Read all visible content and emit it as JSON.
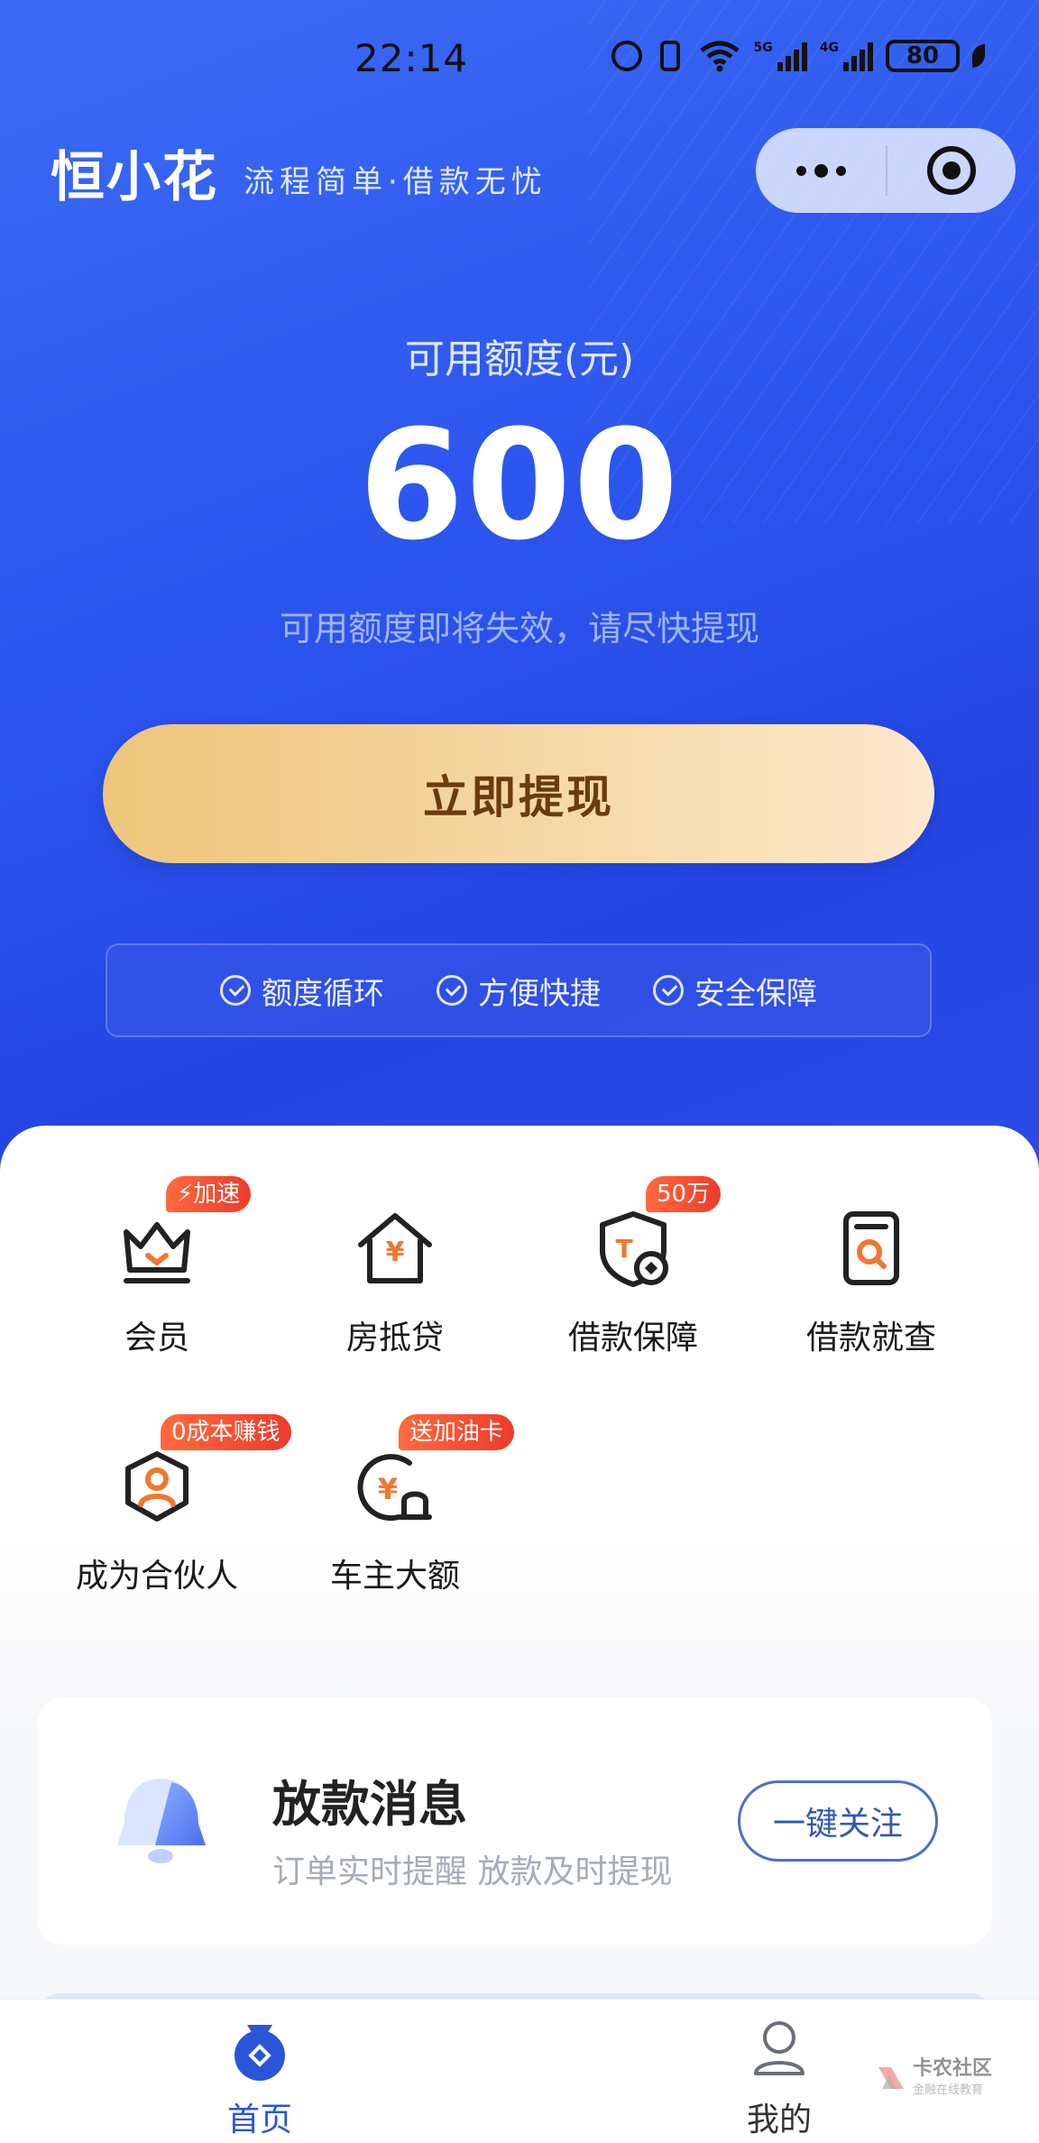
{
  "status_bar": {
    "time": "22:14",
    "network_a": "5G",
    "network_b": "4G",
    "battery": "80",
    "icons": [
      "alarm-icon",
      "vibrate-icon",
      "wifi-icon",
      "signal-5g-icon",
      "signal-4g-icon",
      "battery-icon",
      "leaf-icon"
    ]
  },
  "header": {
    "brand": "恒小花",
    "slogan": "流程简单·借款无忧",
    "capsule_icons": [
      "more-dots-icon",
      "close-target-icon"
    ]
  },
  "quota": {
    "label": "可用额度(元)",
    "value": "600",
    "tip": "可用额度即将失效，请尽快提现"
  },
  "cta": {
    "label": "立即提现"
  },
  "features": [
    {
      "label": "额度循环",
      "icon": "check-circle-icon"
    },
    {
      "label": "方便快捷",
      "icon": "check-circle-icon"
    },
    {
      "label": "安全保障",
      "icon": "check-circle-icon"
    }
  ],
  "services": [
    {
      "label": "会员",
      "icon": "crown-icon",
      "badge": "加速"
    },
    {
      "label": "房抵贷",
      "icon": "house-yuan-icon",
      "badge": ""
    },
    {
      "label": "借款保障",
      "icon": "shield-icon",
      "badge": "50万"
    },
    {
      "label": "借款就查",
      "icon": "search-doc-icon",
      "badge": ""
    },
    {
      "label": "成为合伙人",
      "icon": "partner-icon",
      "badge": "0成本赚钱"
    },
    {
      "label": "车主大额",
      "icon": "car-loan-icon",
      "badge": "送加油卡"
    }
  ],
  "notice": {
    "title": "放款消息",
    "subtitle": "订单实时提醒 放款及时提现",
    "button": "一键关注",
    "icon": "bell-icon"
  },
  "tabbar": [
    {
      "label": "首页",
      "icon": "home-bag-icon",
      "active": true
    },
    {
      "label": "我的",
      "icon": "user-icon",
      "active": false
    }
  ],
  "watermark": {
    "title": "卡农社区",
    "subtitle": "金融在线教育"
  },
  "colors": {
    "hero_blue": "#2c55ee",
    "cta_gold": "#eec57b",
    "badge_red": "#ef3a2a",
    "icon_orange": "#f0772e",
    "tab_active": "#2b55d7"
  }
}
